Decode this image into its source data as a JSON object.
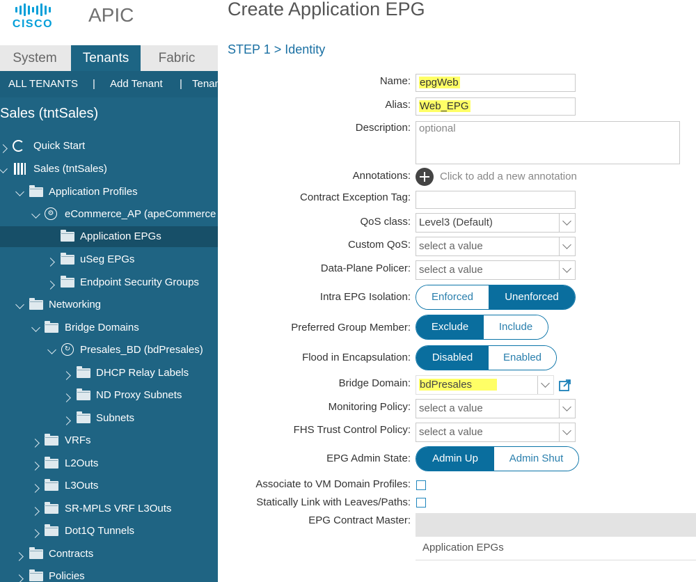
{
  "header": {
    "logo_text": "CISCO",
    "app_name": "APIC"
  },
  "nav_tabs": [
    {
      "label": "System",
      "active": false
    },
    {
      "label": "Tenants",
      "active": true
    },
    {
      "label": "Fabric",
      "active": false
    }
  ],
  "tenant_bar": {
    "all_tenants": "ALL TENANTS",
    "separator": "|",
    "add_tenant": "Add Tenant",
    "tenant_search": "Tenan"
  },
  "tenant_title": "Sales (tntSales)",
  "tree": [
    {
      "label": "Quick Start",
      "icon": "quick-start-icon",
      "expanded": false
    },
    {
      "label": "Sales (tntSales)",
      "icon": "tenant-icon",
      "expanded": true
    },
    {
      "label": "Application Profiles",
      "icon": "folder-icon",
      "expanded": true
    },
    {
      "label": "eCommerce_AP (apeCommerce",
      "icon": "application-profile-icon",
      "expanded": true
    },
    {
      "label": "Application EPGs",
      "icon": "folder-icon",
      "selected": true
    },
    {
      "label": "uSeg EPGs",
      "icon": "folder-icon",
      "expanded": false
    },
    {
      "label": "Endpoint Security Groups",
      "icon": "folder-icon",
      "expanded": false
    },
    {
      "label": "Networking",
      "icon": "folder-icon",
      "expanded": true
    },
    {
      "label": "Bridge Domains",
      "icon": "folder-icon",
      "expanded": true
    },
    {
      "label": "Presales_BD (bdPresales)",
      "icon": "bridge-domain-icon",
      "expanded": true
    },
    {
      "label": "DHCP Relay Labels",
      "icon": "folder-icon",
      "expanded": false
    },
    {
      "label": "ND Proxy Subnets",
      "icon": "folder-icon",
      "expanded": false
    },
    {
      "label": "Subnets",
      "icon": "folder-icon",
      "expanded": false
    },
    {
      "label": "VRFs",
      "icon": "folder-icon",
      "expanded": false
    },
    {
      "label": "L2Outs",
      "icon": "folder-icon",
      "expanded": false
    },
    {
      "label": "L3Outs",
      "icon": "folder-icon",
      "expanded": false
    },
    {
      "label": "SR-MPLS VRF L3Outs",
      "icon": "folder-icon",
      "expanded": false
    },
    {
      "label": "Dot1Q Tunnels",
      "icon": "folder-icon",
      "expanded": false
    },
    {
      "label": "Contracts",
      "icon": "folder-icon",
      "expanded": false
    },
    {
      "label": "Policies",
      "icon": "folder-icon",
      "expanded": false
    }
  ],
  "form": {
    "title": "Create Application EPG",
    "step": "STEP 1 > Identity",
    "name": {
      "label": "Name:",
      "value": "epgWeb"
    },
    "alias": {
      "label": "Alias:",
      "value": "Web_EPG"
    },
    "description": {
      "label": "Description:",
      "placeholder": "optional"
    },
    "annotations": {
      "label": "Annotations:",
      "hint": "Click to add a new annotation"
    },
    "contract_exception_tag": {
      "label": "Contract Exception Tag:",
      "value": ""
    },
    "qos_class": {
      "label": "QoS class:",
      "value": "Level3 (Default)"
    },
    "custom_qos": {
      "label": "Custom QoS:",
      "value": "select a value"
    },
    "data_plane_policer": {
      "label": "Data-Plane Policer:",
      "value": "select a value"
    },
    "intra_epg_isolation": {
      "label": "Intra EPG Isolation:",
      "options": [
        "Enforced",
        "Unenforced"
      ],
      "selected": "Unenforced"
    },
    "preferred_group_member": {
      "label": "Preferred Group Member:",
      "options": [
        "Exclude",
        "Include"
      ],
      "selected": "Exclude"
    },
    "flood_in_encapsulation": {
      "label": "Flood in Encapsulation:",
      "options": [
        "Disabled",
        "Enabled"
      ],
      "selected": "Disabled"
    },
    "bridge_domain": {
      "label": "Bridge Domain:",
      "value": "bdPresales"
    },
    "monitoring_policy": {
      "label": "Monitoring Policy:",
      "value": "select a value"
    },
    "fhs_trust_control_policy": {
      "label": "FHS Trust Control Policy:",
      "value": "select a value"
    },
    "epg_admin_state": {
      "label": "EPG Admin State:",
      "options": [
        "Admin Up",
        "Admin Shut"
      ],
      "selected": "Admin Up"
    },
    "associate_vm_domain": {
      "label": "Associate to VM Domain Profiles:",
      "checked": false
    },
    "statically_link": {
      "label": "Statically Link with Leaves/Paths:",
      "checked": false
    },
    "epg_contract_master": {
      "label": "EPG Contract Master:",
      "column": "Application EPGs"
    }
  },
  "colors": {
    "accent": "#0a6e9e",
    "tree_bg": "#1f6483",
    "highlight": "#ffff66",
    "cisco_blue": "#049fd9"
  }
}
